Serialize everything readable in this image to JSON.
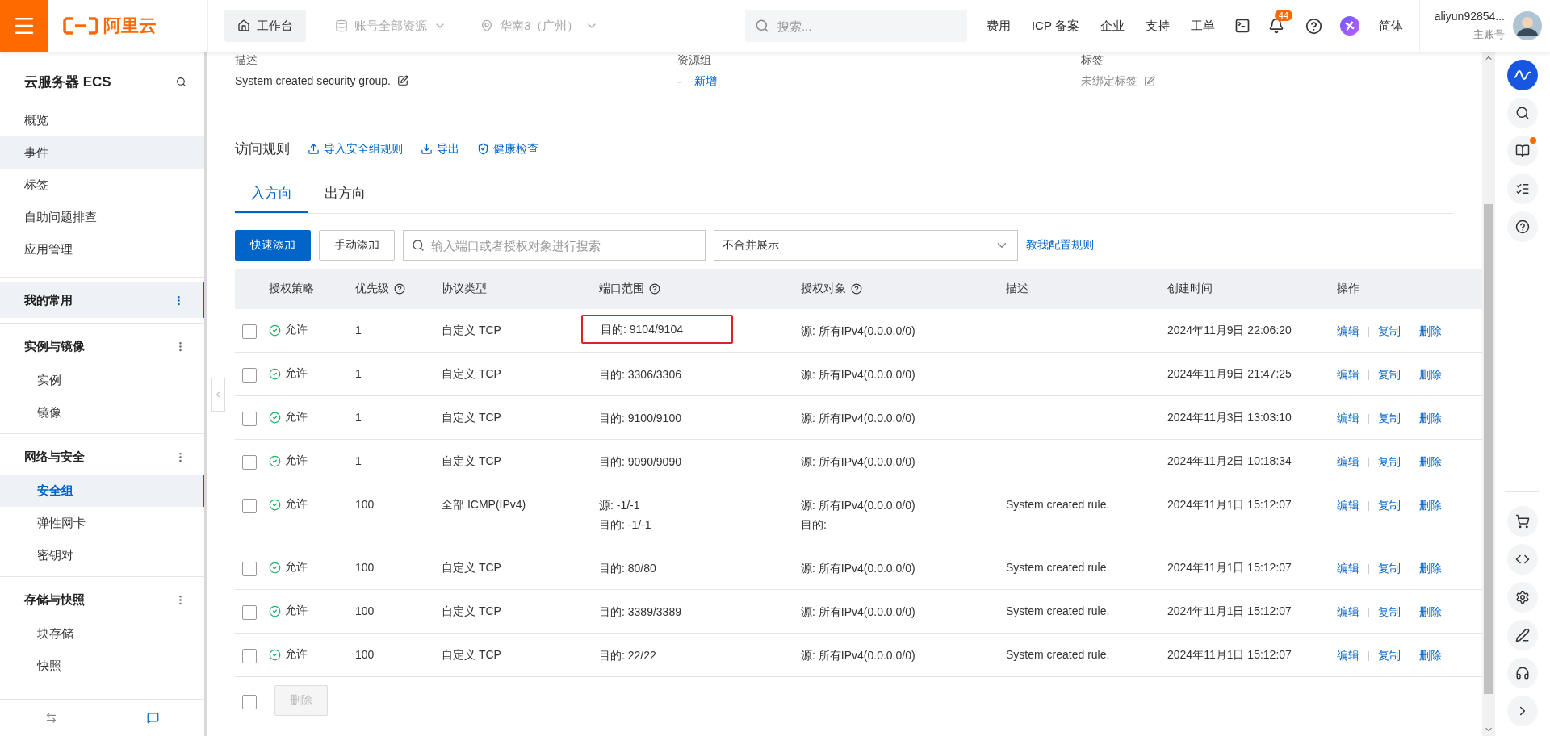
{
  "topbar": {
    "logo_text": "阿里云",
    "workbench": "工作台",
    "scopes": [
      {
        "label": "账号全部资源",
        "kind": "resource",
        "disabled": true
      },
      {
        "label": "华南3（广州）",
        "kind": "region",
        "disabled": true
      }
    ],
    "search": {
      "placeholder": "搜索..."
    },
    "links": [
      "费用",
      "ICP 备案",
      "企业",
      "支持",
      "工单"
    ],
    "notification_count": "44",
    "language": "简体",
    "user": {
      "name": "aliyun92854...",
      "role": "主账号"
    }
  },
  "sidebar": {
    "title": "云服务器 ECS",
    "items": [
      {
        "label": "概览",
        "highlighted": false
      },
      {
        "label": "事件",
        "highlighted": true
      },
      {
        "label": "标签",
        "highlighted": false
      },
      {
        "label": "自助问题排查",
        "highlighted": false
      },
      {
        "label": "应用管理",
        "highlighted": false
      }
    ],
    "groups": [
      {
        "title": "我的常用",
        "selected": true
      },
      {
        "title": "实例与镜像",
        "selected": false,
        "children": [
          {
            "label": "实例",
            "selected": false
          },
          {
            "label": "镜像",
            "selected": false
          }
        ]
      },
      {
        "title": "网络与安全",
        "selected": false,
        "children": [
          {
            "label": "安全组",
            "selected": true
          },
          {
            "label": "弹性网卡",
            "selected": false
          },
          {
            "label": "密钥对",
            "selected": false
          }
        ]
      },
      {
        "title": "存储与快照",
        "selected": false,
        "children": [
          {
            "label": "块存储",
            "selected": false
          },
          {
            "label": "快照",
            "selected": false
          }
        ]
      }
    ]
  },
  "info": [
    {
      "label": "描述",
      "value": "System created security group.",
      "editable": true
    },
    {
      "label": "资源组",
      "value": "-",
      "link": "新增",
      "editable": false
    },
    {
      "label": "标签",
      "value": "未绑定标签",
      "editable": true
    }
  ],
  "rules": {
    "title": "访问规则",
    "actions": [
      {
        "label": "导入安全组规则",
        "kind": "import"
      },
      {
        "label": "导出",
        "kind": "export"
      },
      {
        "label": "健康检查",
        "kind": "check"
      }
    ],
    "tabs": [
      {
        "label": "入方向",
        "selected": true
      },
      {
        "label": "出方向",
        "selected": false
      }
    ],
    "primary_button": "快速添加",
    "secondary_button": "手动添加",
    "search": {
      "placeholder": "输入端口或者授权对象进行搜索"
    },
    "merge_select": "不合并展示",
    "help_link": "教我配置规则",
    "columns": [
      {
        "label": "授权策略",
        "help": false
      },
      {
        "label": "优先级",
        "help": true
      },
      {
        "label": "协议类型",
        "help": false
      },
      {
        "label": "端口范围",
        "help": true
      },
      {
        "label": "授权对象",
        "help": true
      },
      {
        "label": "描述",
        "help": false
      },
      {
        "label": "创建时间",
        "help": false
      },
      {
        "label": "操作",
        "help": false
      }
    ],
    "rows": [
      {
        "checked": false,
        "policy": "允许",
        "priority": "1",
        "protocol": "自定义 TCP",
        "port": [
          "目的: 9104/9104"
        ],
        "target": [
          "源: 所有IPv4(0.0.0.0/0)"
        ],
        "created": "2024年11月9日 22:06:20",
        "actions": [
          "编辑",
          "复制",
          "删除"
        ],
        "highlighted": true
      },
      {
        "checked": false,
        "policy": "允许",
        "priority": "1",
        "protocol": "自定义 TCP",
        "port": [
          "目的: 3306/3306"
        ],
        "target": [
          "源: 所有IPv4(0.0.0.0/0)"
        ],
        "created": "2024年11月9日 21:47:25",
        "actions": [
          "编辑",
          "复制",
          "删除"
        ],
        "highlighted": false
      },
      {
        "checked": false,
        "policy": "允许",
        "priority": "1",
        "protocol": "自定义 TCP",
        "port": [
          "目的: 9100/9100"
        ],
        "target": [
          "源: 所有IPv4(0.0.0.0/0)"
        ],
        "created": "2024年11月3日 13:03:10",
        "actions": [
          "编辑",
          "复制",
          "删除"
        ],
        "highlighted": false
      },
      {
        "checked": false,
        "policy": "允许",
        "priority": "1",
        "protocol": "自定义 TCP",
        "port": [
          "目的: 9090/9090"
        ],
        "target": [
          "源: 所有IPv4(0.0.0.0/0)"
        ],
        "created": "2024年11月2日 10:18:34",
        "actions": [
          "编辑",
          "复制",
          "删除"
        ],
        "highlighted": false
      },
      {
        "checked": false,
        "policy": "允许",
        "priority": "100",
        "protocol": "全部 ICMP(IPv4)",
        "port": [
          "源: -1/-1",
          "目的: -1/-1"
        ],
        "target": [
          "源: 所有IPv4(0.0.0.0/0)",
          "目的:"
        ],
        "description": "System created rule.",
        "created": "2024年11月1日 15:12:07",
        "actions": [
          "编辑",
          "复制",
          "删除"
        ],
        "highlighted": false
      },
      {
        "checked": false,
        "policy": "允许",
        "priority": "100",
        "protocol": "自定义 TCP",
        "port": [
          "目的: 80/80"
        ],
        "target": [
          "源: 所有IPv4(0.0.0.0/0)"
        ],
        "description": "System created rule.",
        "created": "2024年11月1日 15:12:07",
        "actions": [
          "编辑",
          "复制",
          "删除"
        ],
        "highlighted": false
      },
      {
        "checked": false,
        "policy": "允许",
        "priority": "100",
        "protocol": "自定义 TCP",
        "port": [
          "目的: 3389/3389"
        ],
        "target": [
          "源: 所有IPv4(0.0.0.0/0)"
        ],
        "description": "System created rule.",
        "created": "2024年11月1日 15:12:07",
        "actions": [
          "编辑",
          "复制",
          "删除"
        ],
        "highlighted": false
      },
      {
        "checked": false,
        "policy": "允许",
        "priority": "100",
        "protocol": "自定义 TCP",
        "port": [
          "目的: 22/22"
        ],
        "target": [
          "源: 所有IPv4(0.0.0.0/0)"
        ],
        "description": "System created rule.",
        "created": "2024年11月1日 15:12:07",
        "actions": [
          "编辑",
          "复制",
          "删除"
        ],
        "highlighted": false
      }
    ],
    "footer": {
      "checked": false,
      "delete_button": {
        "label": "删除",
        "disabled": true
      }
    }
  }
}
